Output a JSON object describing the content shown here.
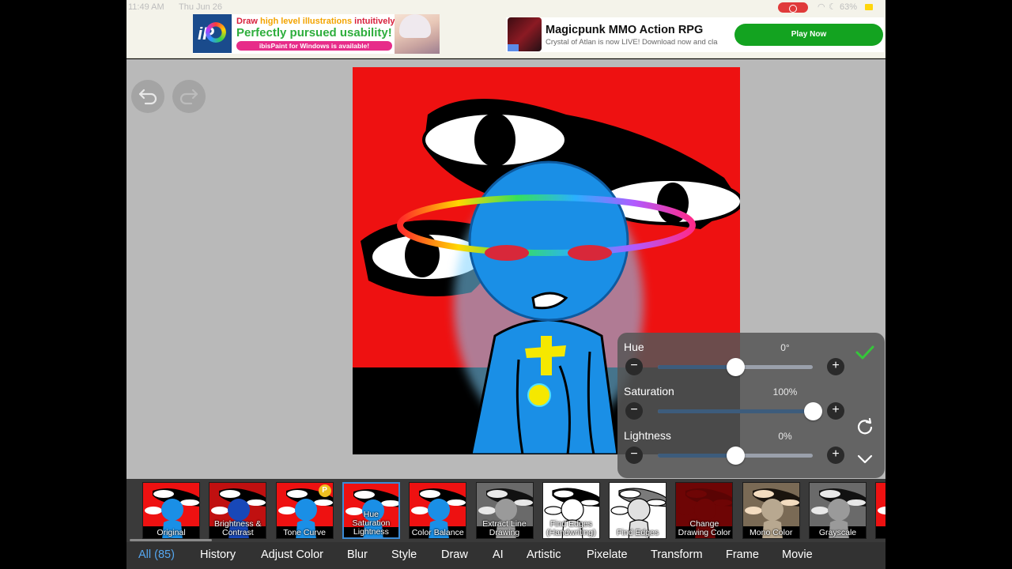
{
  "status_bar": {
    "time": "11:49 AM",
    "date": "Thu Jun 26",
    "battery": "63%"
  },
  "ad_left": {
    "line1_a": "Draw ",
    "line1_b": "high level illustrations",
    "line1_c": " intuitively!",
    "line2": "Perfectly pursued usability!",
    "line3": "ibisPaint for Windows is available!",
    "logo_text": "iP"
  },
  "ad_right": {
    "title": "Magicpunk MMO Action RPG",
    "subtitle": "Crystal of Atlan is now LIVE! Download now and cla",
    "button": "Play Now"
  },
  "adjust_panel": {
    "sliders": [
      {
        "label": "Hue",
        "value": "0°",
        "level": 0.5
      },
      {
        "label": "Saturation",
        "value": "100%",
        "level": 1.0
      },
      {
        "label": "Lightness",
        "value": "0%",
        "level": 0.5
      }
    ],
    "accent": "#3d5c7c",
    "confirm_color": "#35c63a"
  },
  "filters": [
    {
      "label": "Original",
      "style": "normal"
    },
    {
      "label": "Brightness & Contrast",
      "style": "dark"
    },
    {
      "label": "Tone Curve",
      "style": "normal",
      "premium": "P"
    },
    {
      "label": "Hue Saturation Lightness",
      "style": "normal",
      "selected": true
    },
    {
      "label": "Color Balance",
      "style": "normal"
    },
    {
      "label": "Extract Line Drawing",
      "style": "gray"
    },
    {
      "label": "Find Edges (Handwriting)",
      "style": "edges"
    },
    {
      "label": "Find Edges",
      "style": "edges-gray"
    },
    {
      "label": "Change Drawing Color",
      "style": "darkred"
    },
    {
      "label": "Mono Color",
      "style": "sepia"
    },
    {
      "label": "Grayscale",
      "style": "gray"
    },
    {
      "label": "Bl",
      "style": "normal"
    }
  ],
  "categories": [
    {
      "label": "All (85)",
      "active": true
    },
    {
      "label": "History"
    },
    {
      "label": "Adjust Color"
    },
    {
      "label": "Blur"
    },
    {
      "label": "Style"
    },
    {
      "label": "Draw"
    },
    {
      "label": "AI"
    },
    {
      "label": "Artistic"
    },
    {
      "label": "Pixelate"
    },
    {
      "label": "Transform"
    },
    {
      "label": "Frame"
    },
    {
      "label": "Movie"
    }
  ],
  "colors": {
    "canvas_bg": "#ee1111",
    "character": "#1a8fe6",
    "workspace": "#b9b9b9",
    "active_tab": "#55a7f0"
  }
}
